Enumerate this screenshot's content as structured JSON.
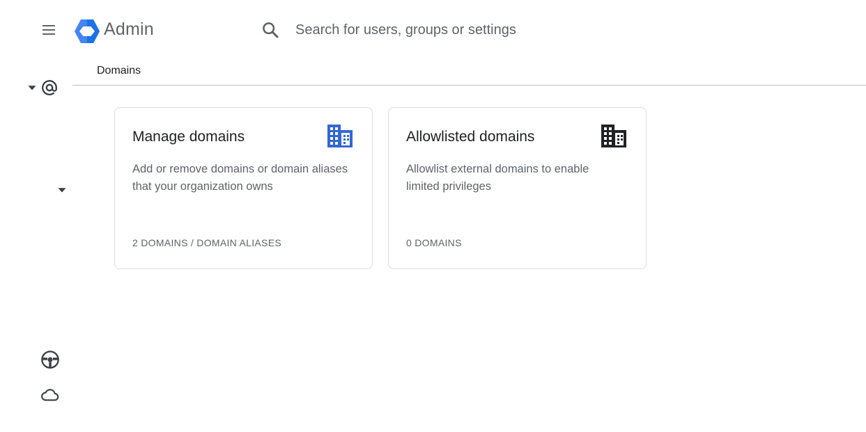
{
  "header": {
    "app_title": "Admin",
    "search_placeholder": "Search for users, groups or settings",
    "logo_color": "#4285f4"
  },
  "breadcrumb": {
    "label": "Domains"
  },
  "rail": {
    "icons": [
      "at-sign-icon",
      "steering-wheel-icon",
      "cloud-icon"
    ]
  },
  "cards": [
    {
      "title": "Manage domains",
      "description": "Add or remove domains or domain aliases that your organization owns",
      "footer": "2 DOMAINS / DOMAIN ALIASES",
      "icon": "building-icon",
      "icon_color": "#3367d6"
    },
    {
      "title": "Allowlisted domains",
      "description": "Allowlist external domains to enable limited privileges",
      "footer": "0 DOMAINS",
      "icon": "building-icon",
      "icon_color": "#202124"
    }
  ]
}
